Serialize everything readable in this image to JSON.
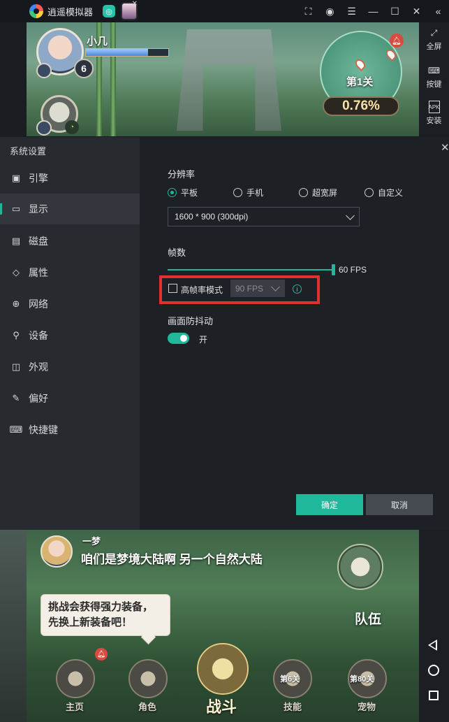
{
  "titlebar": {
    "app_name": "逍遥模拟器",
    "controls": [
      "screenshot-icon",
      "account-icon",
      "menu-icon",
      "minimize-icon",
      "maximize-icon",
      "close-icon",
      "collapse-icon"
    ]
  },
  "right_toolbar": {
    "items": [
      {
        "label": "全屏",
        "icon": "fullscreen-icon"
      },
      {
        "label": "按键",
        "icon": "keyboard-icon"
      },
      {
        "label": "安装",
        "icon": "apk-icon"
      }
    ],
    "apk_text": "APK"
  },
  "game_top": {
    "player_name": "小几",
    "level": "6",
    "stage": "第1关",
    "progress": "0.76%",
    "exp_fraction": 0.75
  },
  "settings": {
    "title": "系统设置",
    "nav": [
      {
        "label": "引擎",
        "icon": "chip-icon"
      },
      {
        "label": "显示",
        "icon": "monitor-icon"
      },
      {
        "label": "磁盘",
        "icon": "disk-icon"
      },
      {
        "label": "属性",
        "icon": "tag-icon"
      },
      {
        "label": "网络",
        "icon": "globe-icon"
      },
      {
        "label": "设备",
        "icon": "mic-icon"
      },
      {
        "label": "外观",
        "icon": "window-icon"
      },
      {
        "label": "偏好",
        "icon": "wrench-icon"
      },
      {
        "label": "快捷键",
        "icon": "keyboard-icon"
      }
    ],
    "active_nav": "显示",
    "resolution": {
      "label": "分辨率",
      "options": [
        "平板",
        "手机",
        "超宽屏",
        "自定义"
      ],
      "selected": "平板",
      "value": "1600 * 900 (300dpi)"
    },
    "fps": {
      "label": "帧数",
      "value": "60 FPS",
      "high_fps_label": "高帧率模式",
      "high_fps_checked": false,
      "high_fps_value": "90 FPS",
      "info": "i"
    },
    "stabilization": {
      "label": "画面防抖动",
      "toggle_text": "开",
      "enabled": true
    },
    "buttons": {
      "confirm": "确定",
      "cancel": "取消"
    },
    "accent": "#1fb89a",
    "highlight": "#e0302f"
  },
  "game_bottom": {
    "speaker": "一梦",
    "dialog": "咱们是梦境大陆啊 另一个自然大陆",
    "tip": "挑战会获得强力装备，先换上新装备吧！",
    "team": "队伍",
    "nav": [
      {
        "label": "主页",
        "icon": "home-icon"
      },
      {
        "label": "角色",
        "icon": "character-icon"
      },
      {
        "label": "战斗",
        "icon": "battle-icon"
      },
      {
        "label": "技能",
        "icon": "skill-icon",
        "lock": "第6关"
      },
      {
        "label": "宠物",
        "icon": "pet-icon",
        "lock": "第80关"
      }
    ]
  }
}
